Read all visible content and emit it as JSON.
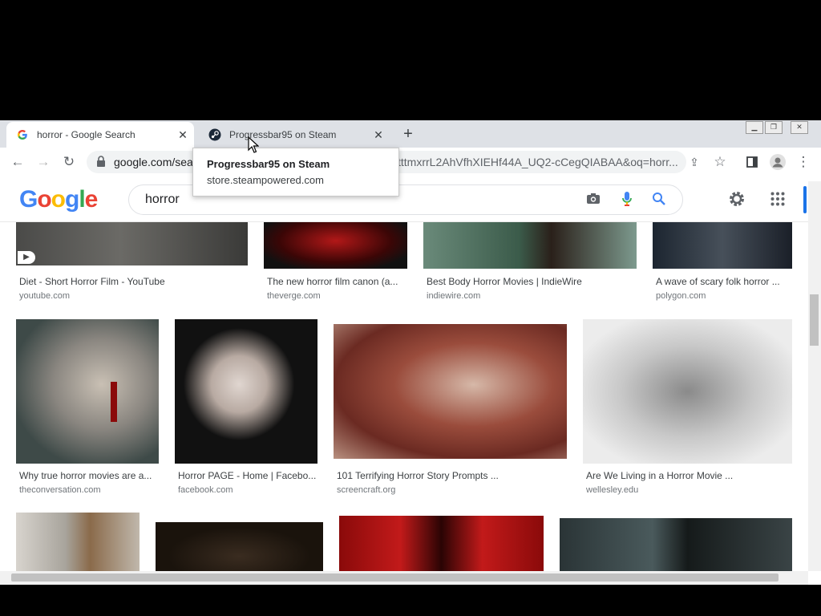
{
  "tabs": [
    {
      "title": "horror - Google Search",
      "favicon": "google-icon"
    },
    {
      "title": "Progressbar95 on Steam",
      "favicon": "steam-icon"
    }
  ],
  "toolbar": {
    "url_start": "google.com/sea",
    "url_end": "tttmxrrL2AhVfhXIEHf44A_UQ2-cCegQIABAA&oq=horr..."
  },
  "tooltip": {
    "title": "Progressbar95 on Steam",
    "url": "store.steampowered.com"
  },
  "google": {
    "query": "horror"
  },
  "results": [
    {
      "caption": "Diet - Short Horror Film - YouTube",
      "source": "youtube.com"
    },
    {
      "caption": "The new horror film canon (a...",
      "source": "theverge.com"
    },
    {
      "caption": "Best Body Horror Movies | IndieWire",
      "source": "indiewire.com"
    },
    {
      "caption": "A wave of scary folk horror ...",
      "source": "polygon.com"
    },
    {
      "caption": "Why true horror movies are a...",
      "source": "theconversation.com"
    },
    {
      "caption": "Horror PAGE - Home | Facebo...",
      "source": "facebook.com"
    },
    {
      "caption": "101 Terrifying Horror Story Prompts ...",
      "source": "screencraft.org"
    },
    {
      "caption": "Are We Living in a Horror Movie ...",
      "source": "wellesley.edu"
    }
  ],
  "colors": {
    "google_blue": "#4285F4",
    "google_red": "#EA4335",
    "google_yellow": "#FBBC05",
    "google_green": "#34A853"
  }
}
